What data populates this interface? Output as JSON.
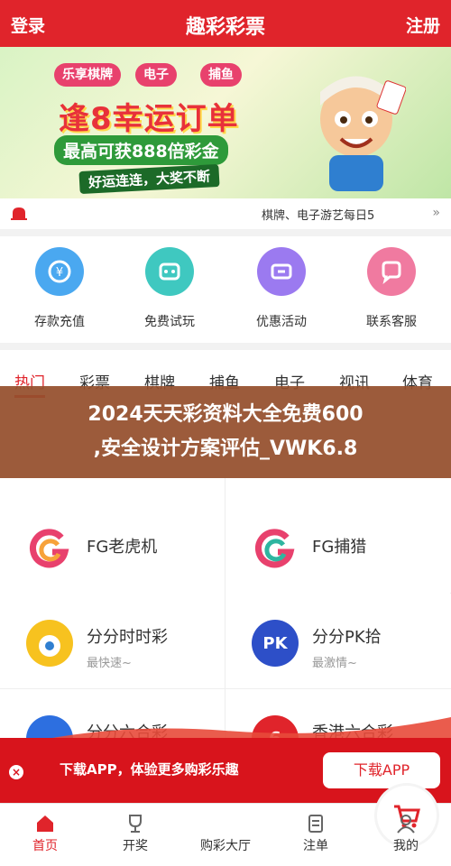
{
  "header": {
    "login": "登录",
    "title": "趣彩彩票",
    "register": "注册"
  },
  "banner": {
    "tags": [
      "乐享棋牌",
      "电子",
      "捕鱼"
    ],
    "headline": "逢8幸运订单",
    "sub1": "最高可获888倍彩金",
    "sub2": "好运连连，大奖不断"
  },
  "notice": {
    "text": "棋牌、电子游艺每日5",
    "more": "»"
  },
  "quick": [
    {
      "label": "存款充值",
      "color": "#4aa8f0"
    },
    {
      "label": "免费试玩",
      "color": "#3fc8c0"
    },
    {
      "label": "优惠活动",
      "color": "#9b7af0"
    },
    {
      "label": "联系客服",
      "color": "#f07aa0"
    }
  ],
  "tabs": [
    "热门",
    "彩票",
    "棋牌",
    "捕鱼",
    "电子",
    "视讯",
    "体育"
  ],
  "overlay": {
    "line1": "2024天天彩资料大全免费600",
    "line2": ",安全设计方案评估_VWK6.8"
  },
  "games": [
    {
      "name": "FG老虎机",
      "sub": ""
    },
    {
      "name": "FG捕猎",
      "sub": ""
    },
    {
      "name": "分分时时彩",
      "sub": "最快速~"
    },
    {
      "name": "分分PK拾",
      "sub": "最激情~"
    },
    {
      "name": "分分六合彩",
      "sub": ""
    },
    {
      "name": "香港六合彩",
      "sub": ""
    }
  ],
  "promo": {
    "close": "×",
    "text": "下载APP，体验更多购彩乐趣",
    "button": "下载APP"
  },
  "bottom_nav": [
    {
      "label": "首页"
    },
    {
      "label": "开奖"
    },
    {
      "label": "购彩大厅"
    },
    {
      "label": "注单"
    },
    {
      "label": "我的"
    }
  ]
}
